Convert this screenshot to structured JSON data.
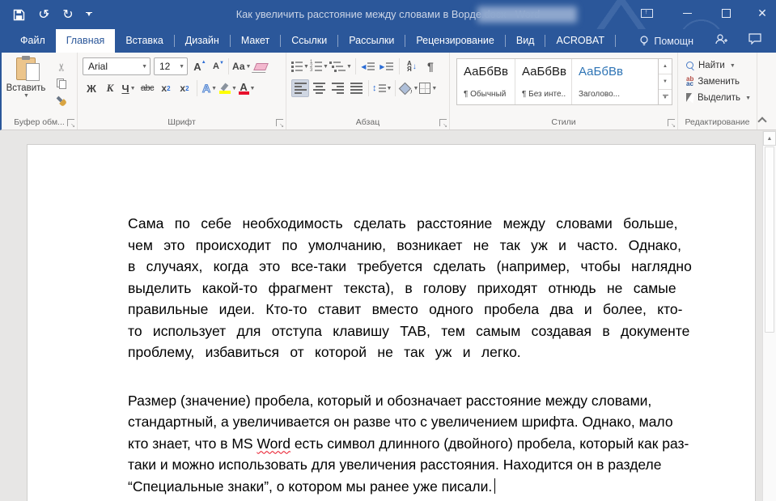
{
  "titlebar": {
    "title": "Как увеличить расстояние между словами в Ворде.docx - Word"
  },
  "tabs": [
    {
      "label": "Файл"
    },
    {
      "label": "Главная"
    },
    {
      "label": "Вставка"
    },
    {
      "label": "Дизайн"
    },
    {
      "label": "Макет"
    },
    {
      "label": "Ссылки"
    },
    {
      "label": "Рассылки"
    },
    {
      "label": "Рецензирование"
    },
    {
      "label": "Вид"
    },
    {
      "label": "ACROBAT"
    }
  ],
  "active_tab": "Главная",
  "helper": {
    "label": "Помощн"
  },
  "ribbon": {
    "clipboard": {
      "group_label": "Буфер обм...",
      "paste_label": "Вставить"
    },
    "font": {
      "group_label": "Шрифт",
      "font_name": "Arial",
      "font_size": "12",
      "bold": "Ж",
      "italic": "К",
      "underline": "Ч",
      "strikethrough": "abc",
      "subscript": "х",
      "superscript": "х",
      "sub_digit": "2",
      "sup_digit": "2",
      "change_case": "Аа",
      "text_effects": "А",
      "font_color_letter": "А"
    },
    "paragraph": {
      "group_label": "Абзац",
      "pilcrow": "¶",
      "sort_top": "А",
      "sort_bottom": "Я",
      "sort_arrow": "↓"
    },
    "styles": {
      "group_label": "Стили",
      "items": [
        {
          "preview": "АаБбВв",
          "name": "¶ Обычный"
        },
        {
          "preview": "АаБбВв",
          "name": "¶ Без инте..."
        },
        {
          "preview": "АаБбВв",
          "name": "Заголово..."
        }
      ]
    },
    "editing": {
      "group_label": "Редактирование",
      "find": "Найти",
      "replace": "Заменить",
      "select": "Выделить",
      "replace_icon_top": "ab",
      "replace_icon_bottom": "ac"
    }
  },
  "document": {
    "p1": "Сама по себе необходимость сделать расстояние между словами больше, чем это происходит по умолчанию, возникает не так уж и часто. Однако, в случаях, когда это все-таки требуется сделать (например, чтобы наглядно выделить какой-то фрагмент текста), в голову приходят отнюдь не самые правильные идеи. Кто-то ставит вместо одного пробела два и более, кто-то использует для отступа клавишу TAB, тем самым создавая в документе проблему, избавиться от которой не так уж и легко.",
    "p2_before": "Размер (значение) пробела, который и обозначает расстояние между словами, стандартный, а увеличивается он разве что с увеличением шрифта. Однако, мало кто знает, что в MS ",
    "p2_word": "Word",
    "p2_after": " есть символ длинного (двойного) пробела, который как раз-таки и можно использовать для увеличения расстояния. Находится он в разделе “Специальные знаки”, о котором мы ранее уже писали."
  },
  "colors": {
    "accent": "#2b579a",
    "highlight_yellow": "#ffff00",
    "font_color_red": "#e8112d",
    "spellcheck_red": "#e81123"
  }
}
